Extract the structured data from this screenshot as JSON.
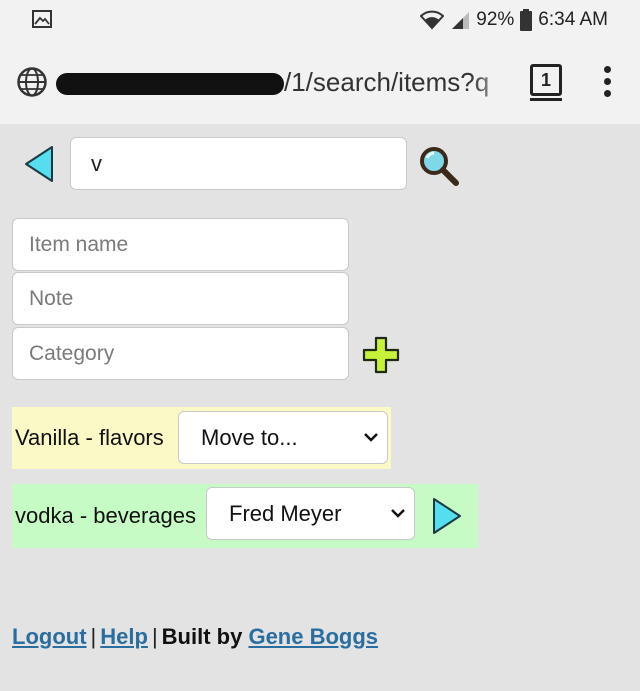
{
  "status_bar": {
    "icons": [
      "gallery-icon",
      "wifi-icon",
      "signal-icon",
      "battery-icon"
    ],
    "battery": "92%",
    "time": "6:34 AM"
  },
  "browser": {
    "url_visible": "/1/search/items?q",
    "tab_count": "1",
    "icons": [
      "globe-icon",
      "tabs-icon",
      "more-vert-icon"
    ]
  },
  "search": {
    "value": "v",
    "icons": [
      "back-triangle-icon",
      "magnifier-icon"
    ]
  },
  "new_item": {
    "name_placeholder": "Item name",
    "note_placeholder": "Note",
    "category_placeholder": "Category",
    "add_icon": "plus-icon"
  },
  "items": [
    {
      "label": "Vanilla - flavors",
      "select_value": "Move to...",
      "color": "#fbf9c6"
    },
    {
      "label": "vodka - beverages",
      "select_value": "Fred Meyer",
      "color": "#c6fbc6",
      "action_icon": "forward-triangle-icon"
    }
  ],
  "footer": {
    "logout": "Logout",
    "sep1": "|",
    "help": "Help",
    "sep2": "|",
    "built_by": "Built by",
    "author": "Gene Boggs"
  },
  "colors": {
    "accent_cyan": "#55ddf0",
    "add_green": "#c6f23a",
    "link_blue": "#2a6ea0"
  }
}
